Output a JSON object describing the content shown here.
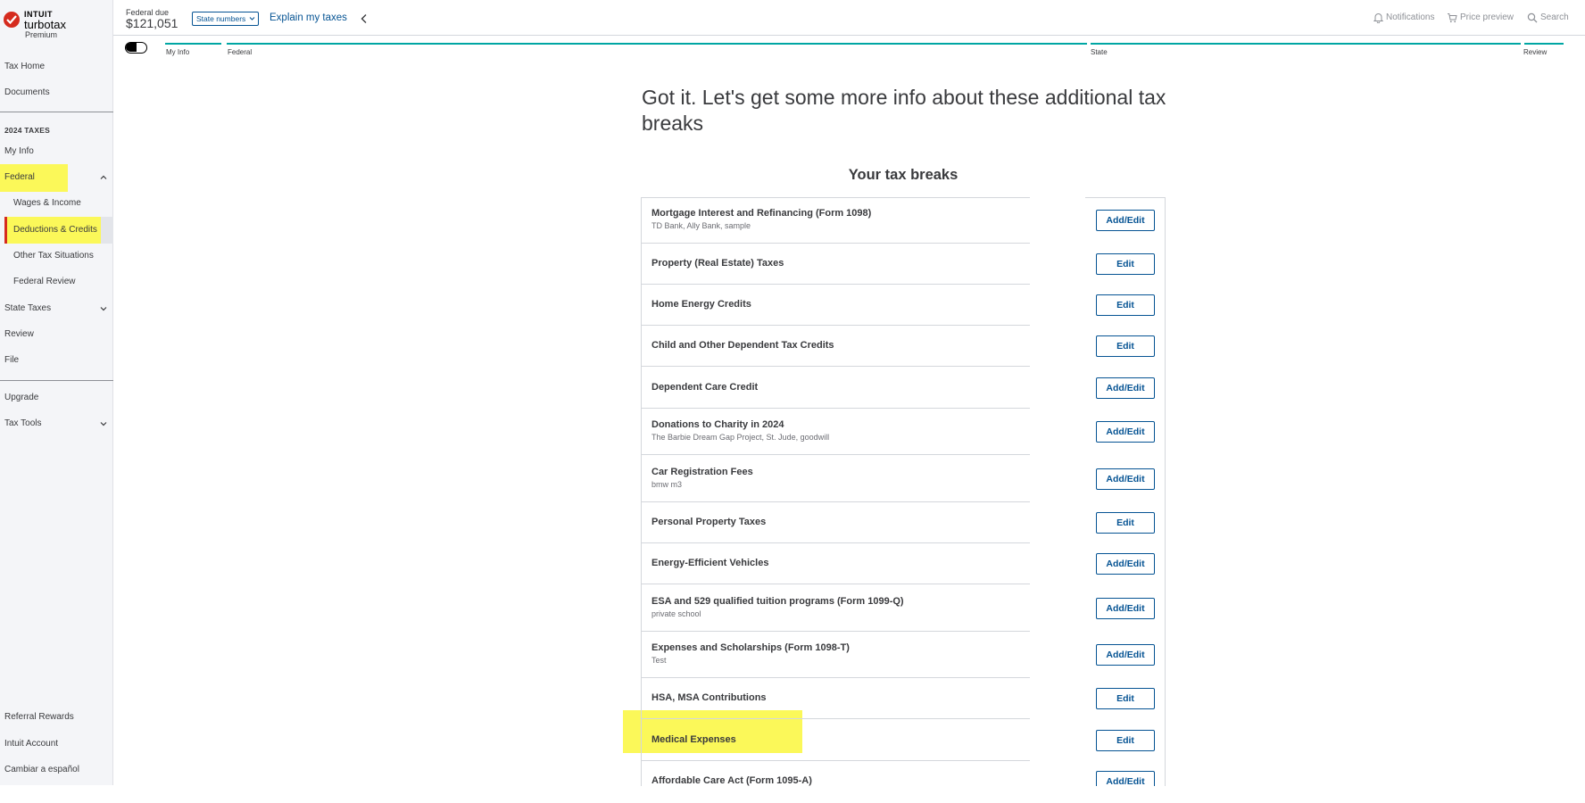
{
  "brand": {
    "company": "INTUIT",
    "product": "turbotax",
    "edition": "Premium"
  },
  "sidebar": {
    "top_items": [
      {
        "label": "Tax Home"
      },
      {
        "label": "Documents"
      }
    ],
    "section_heading": "2024 TAXES",
    "items": [
      {
        "label": "My Info"
      },
      {
        "label": "Federal"
      },
      {
        "label": "Wages & Income"
      },
      {
        "label": "Deductions & Credits"
      },
      {
        "label": "Other Tax Situations"
      },
      {
        "label": "Federal Review"
      },
      {
        "label": "State Taxes"
      },
      {
        "label": "Review"
      },
      {
        "label": "File"
      }
    ],
    "extra_items": [
      {
        "label": "Upgrade"
      },
      {
        "label": "Tax Tools"
      }
    ],
    "footer_items": [
      {
        "label": "Referral Rewards"
      },
      {
        "label": "Intuit Account"
      },
      {
        "label": "Cambiar a español"
      }
    ],
    "highlight_color": "#fbf859",
    "active_marker_color": "#d52b1e"
  },
  "header": {
    "federal_due_label": "Federal due",
    "federal_due_amount": "$121,051",
    "state_numbers_label": "State numbers",
    "explain_label": "Explain my taxes",
    "notifications_label": "Notifications",
    "price_preview_label": "Price preview",
    "search_label": "Search"
  },
  "progress": {
    "steps": [
      {
        "label": "My Info"
      },
      {
        "label": "Federal"
      },
      {
        "label": "State"
      },
      {
        "label": "Review"
      }
    ],
    "accent_color": "#00a6a4"
  },
  "main": {
    "title": "Got it. Let's get some more info about these additional tax breaks",
    "subtitle": "Your tax breaks",
    "breaks": [
      {
        "name": "Mortgage Interest and Refinancing (Form 1098)",
        "detail": "TD Bank, Ally Bank, sample",
        "action": "Add/Edit"
      },
      {
        "name": "Property (Real Estate) Taxes",
        "detail": "",
        "action": "Edit"
      },
      {
        "name": "Home Energy Credits",
        "detail": "",
        "action": "Edit"
      },
      {
        "name": "Child and Other Dependent Tax Credits",
        "detail": "",
        "action": "Edit"
      },
      {
        "name": "Dependent Care Credit",
        "detail": "",
        "action": "Add/Edit"
      },
      {
        "name": "Donations to Charity in 2024",
        "detail": "The Barbie Dream Gap Project, St. Jude, goodwill",
        "action": "Add/Edit"
      },
      {
        "name": "Car Registration Fees",
        "detail": "bmw m3",
        "action": "Add/Edit"
      },
      {
        "name": "Personal Property Taxes",
        "detail": "",
        "action": "Edit"
      },
      {
        "name": "Energy-Efficient Vehicles",
        "detail": "",
        "action": "Add/Edit"
      },
      {
        "name": "ESA and 529 qualified tuition programs (Form 1099-Q)",
        "detail": "private school",
        "action": "Add/Edit"
      },
      {
        "name": "Expenses and Scholarships (Form 1098-T)",
        "detail": "Test",
        "action": "Add/Edit"
      },
      {
        "name": "HSA, MSA Contributions",
        "detail": "",
        "action": "Edit"
      },
      {
        "name": "Medical Expenses",
        "detail": "",
        "action": "Edit"
      },
      {
        "name": "Affordable Care Act (Form 1095-A)",
        "detail": "",
        "action": "Add/Edit"
      }
    ],
    "button_color": "#055393"
  }
}
